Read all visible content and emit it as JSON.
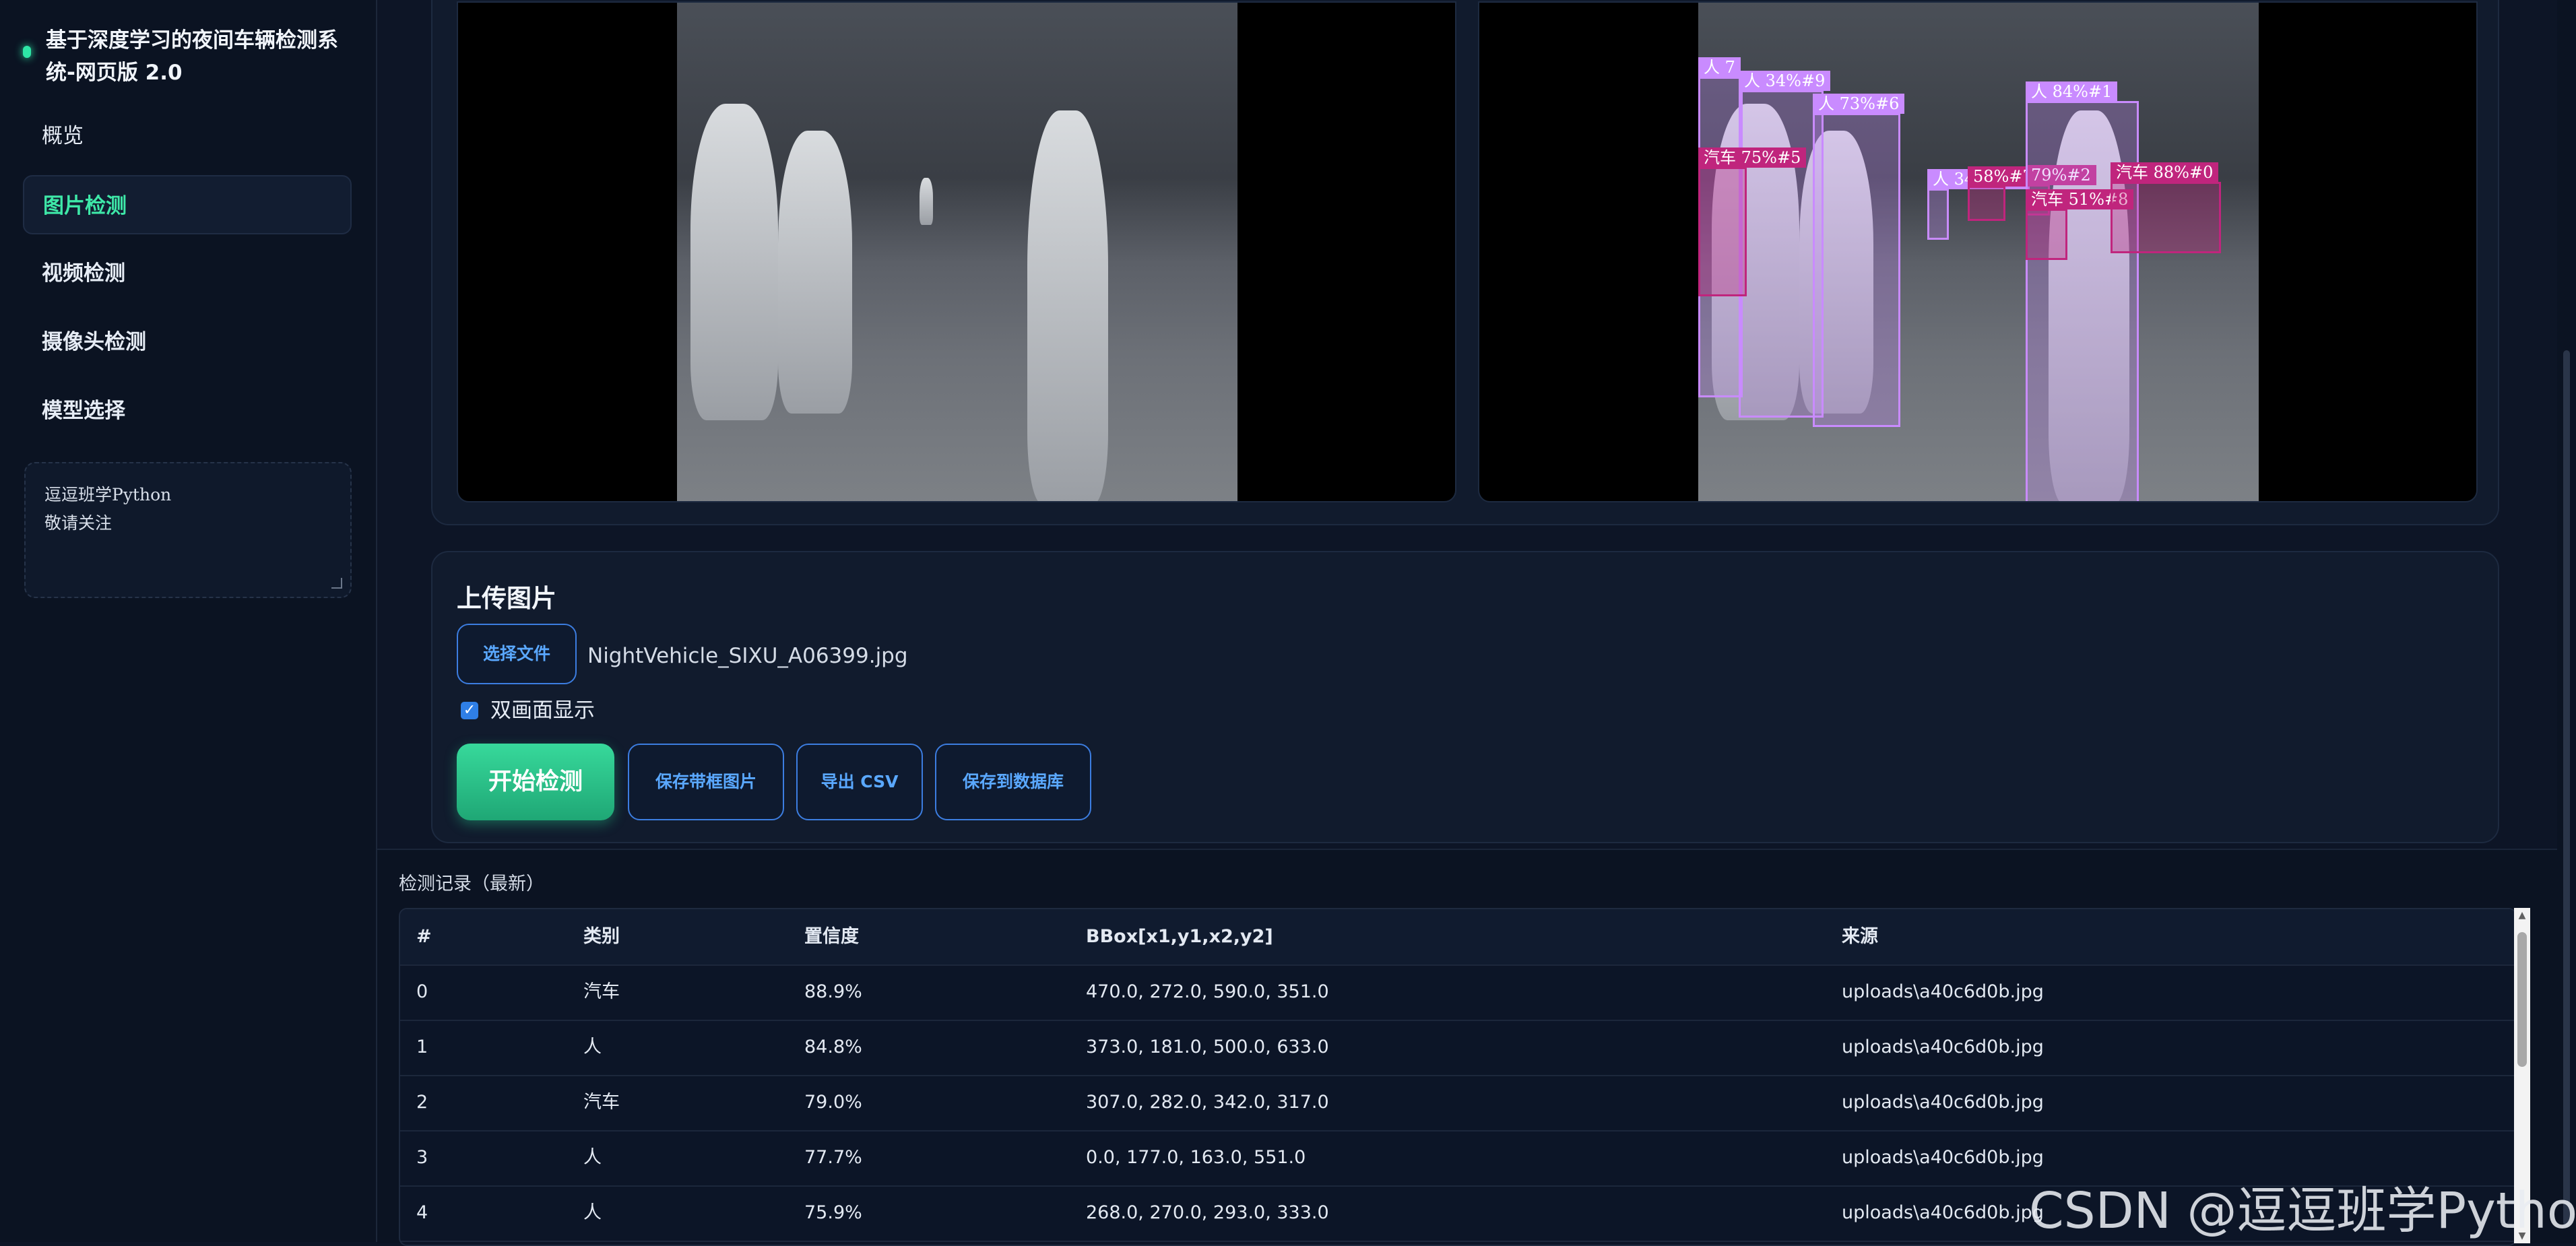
{
  "sidebar": {
    "title": "基于深度学习的夜间车辆检测系统-网页版 2.0",
    "nav": [
      "概览",
      "图片检测",
      "视频检测",
      "摄像头检测",
      "模型选择"
    ],
    "active_index": 1,
    "note_lines": [
      "逗逗班学Python",
      "敬请关注"
    ]
  },
  "preview": {
    "detections": [
      {
        "label": "人 7",
        "type": "person"
      },
      {
        "label": "人 34%#9",
        "type": "person"
      },
      {
        "label": "人 73%#6",
        "type": "person"
      },
      {
        "label": "汽车 75%#5",
        "type": "car"
      },
      {
        "label": "人 34%#10",
        "type": "person"
      },
      {
        "label": "58%#7",
        "type": "car"
      },
      {
        "label": "79%#2",
        "type": "car"
      },
      {
        "label": "人 84%#1",
        "type": "person"
      },
      {
        "label": "汽车 51%#8",
        "type": "car"
      },
      {
        "label": "汽车 88%#0",
        "type": "car"
      }
    ]
  },
  "upload": {
    "title": "上传图片",
    "choose_file": "选择文件",
    "file_name": "NightVehicle_SIXU_A06399.jpg",
    "dual_view_label": "双画面显示",
    "dual_view_checked": true,
    "start_button": "开始检测",
    "save_image_button": "保存带框图片",
    "export_csv_button": "导出 CSV",
    "save_db_button": "保存到数据库"
  },
  "records": {
    "title": "检测记录（最新）",
    "columns": [
      "#",
      "类别",
      "置信度",
      "BBox[x1,y1,x2,y2]",
      "来源"
    ],
    "rows": [
      [
        "0",
        "汽车",
        "88.9%",
        "470.0, 272.0, 590.0, 351.0",
        "uploads\\a40c6d0b.jpg"
      ],
      [
        "1",
        "人",
        "84.8%",
        "373.0, 181.0, 500.0, 633.0",
        "uploads\\a40c6d0b.jpg"
      ],
      [
        "2",
        "汽车",
        "79.0%",
        "307.0, 282.0, 342.0, 317.0",
        "uploads\\a40c6d0b.jpg"
      ],
      [
        "3",
        "人",
        "77.7%",
        "0.0, 177.0, 163.0, 551.0",
        "uploads\\a40c6d0b.jpg"
      ],
      [
        "4",
        "人",
        "75.9%",
        "268.0, 270.0, 293.0, 333.0",
        "uploads\\a40c6d0b.jpg"
      ]
    ]
  },
  "watermark": "CSDN @逗逗班学Python",
  "colors": {
    "accent": "#3ee8a8",
    "primary_button": "#27c489",
    "outline_button": "#3c7de0",
    "person_box": "#c98bff",
    "car_box": "#c0257d"
  }
}
